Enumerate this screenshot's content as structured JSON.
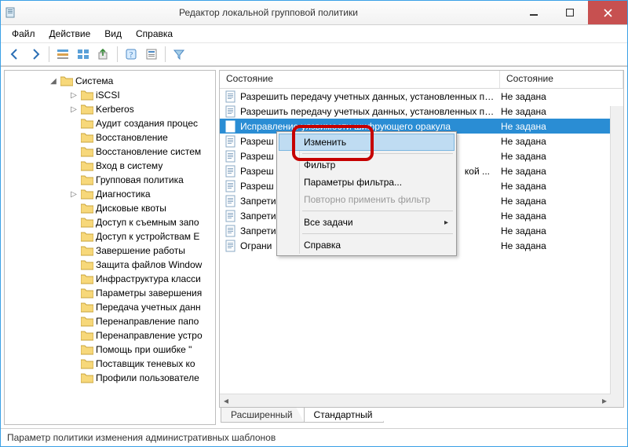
{
  "window": {
    "title": "Редактор локальной групповой политики"
  },
  "menu": {
    "file": "Файл",
    "action": "Действие",
    "view": "Вид",
    "help": "Справка"
  },
  "tree": {
    "root": "Система",
    "items": [
      "iSCSI",
      "Kerberos",
      "Аудит создания процес",
      "Восстановление",
      "Восстановление систем",
      "Вход в систему",
      "Групповая политика",
      "Диагностика",
      "Дисковые квоты",
      "Доступ к съемным запо",
      "Доступ к устройствам E",
      "Завершение работы",
      "Защита файлов Window",
      "Инфраструктура класси",
      "Параметры завершения",
      "Передача учетных данн",
      "Перенаправление папо",
      "Перенаправление устро",
      "Помощь при ошибке \"",
      "Поставщик теневых ко",
      "Профили пользователе"
    ]
  },
  "list": {
    "columns": {
      "name": "Состояние",
      "state": "Состояние"
    },
    "rows": [
      {
        "name": "Разрешить передачу учетных данных, установленных по ...",
        "state": "Не задана"
      },
      {
        "name": "Разрешить передачу учетных данных, установленных по ...",
        "state": "Не задана"
      },
      {
        "name": "Исправление уязвимости шифрующего оракула",
        "state": "Не задана",
        "selected": true
      },
      {
        "name": "Разреш",
        "state": "Не задана"
      },
      {
        "name": "Разреш",
        "state": "Не задана"
      },
      {
        "name": "Разреш",
        "state": "Не задана",
        "suffix": "кой ..."
      },
      {
        "name": "Разреш",
        "state": "Не задана"
      },
      {
        "name": "Запрети",
        "state": "Не задана"
      },
      {
        "name": "Запрети",
        "state": "Не задана"
      },
      {
        "name": "Запрети",
        "state": "Не задана"
      },
      {
        "name": "Ограни",
        "state": "Не задана"
      }
    ]
  },
  "tabs": {
    "extended": "Расширенный",
    "standard": "Стандартный"
  },
  "context_menu": {
    "edit": "Изменить",
    "filter": "Фильтр",
    "filter_params": "Параметры фильтра...",
    "reapply": "Повторно применить фильтр",
    "all_tasks": "Все задачи",
    "help": "Справка"
  },
  "status": "Параметр политики изменения административных шаблонов"
}
